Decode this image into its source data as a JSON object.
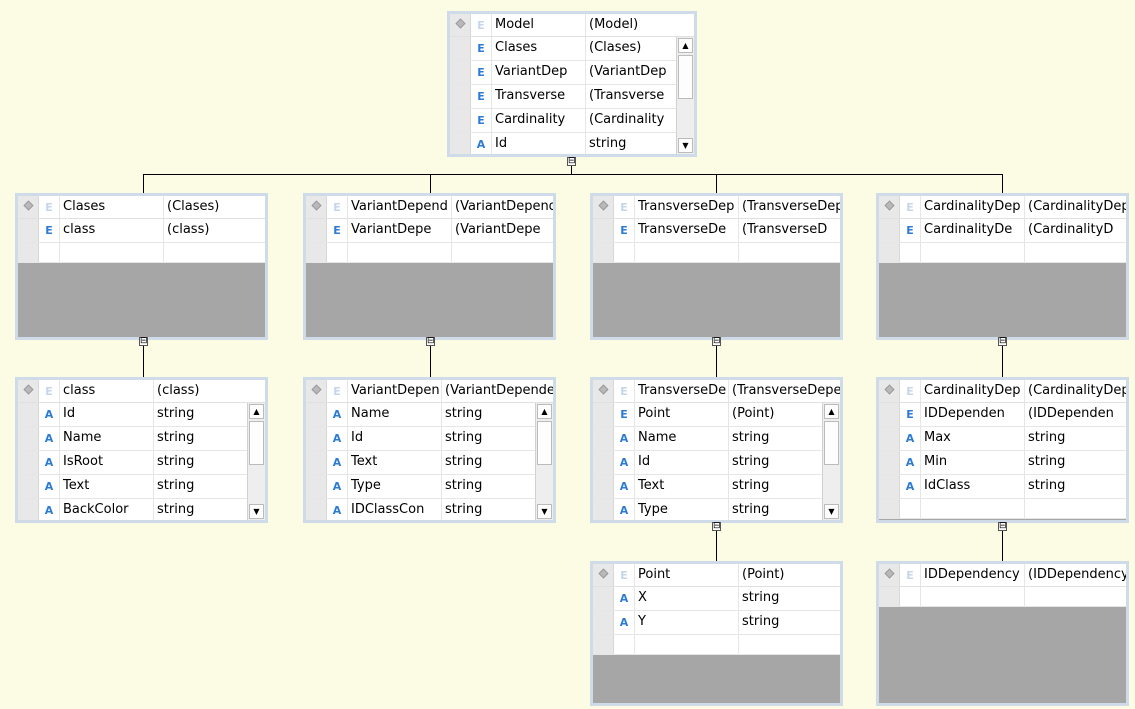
{
  "nodes": [
    {
      "id": "model",
      "header": {
        "name": "Model",
        "type": "(Model)"
      },
      "rows": [
        {
          "kind": "E",
          "name": "Clases",
          "type": "(Clases)"
        },
        {
          "kind": "E",
          "name": "VariantDep",
          "type": "(VariantDep"
        },
        {
          "kind": "E",
          "name": "Transverse",
          "type": "(Transverse"
        },
        {
          "kind": "E",
          "name": "Cardinality",
          "type": "(Cardinality"
        },
        {
          "kind": "A",
          "name": "Id",
          "type": "string"
        }
      ]
    },
    {
      "id": "clases",
      "header": {
        "name": "Clases",
        "type": "(Clases)"
      },
      "rows": [
        {
          "kind": "E",
          "name": "class",
          "type": "(class)"
        }
      ]
    },
    {
      "id": "variant-dependencies",
      "header": {
        "name": "VariantDepend",
        "type": "(VariantDepend"
      },
      "rows": [
        {
          "kind": "E",
          "name": "VariantDepe",
          "type": "(VariantDepe"
        }
      ]
    },
    {
      "id": "transverse-dependencies",
      "header": {
        "name": "TransverseDep",
        "type": "(TransverseDep"
      },
      "rows": [
        {
          "kind": "E",
          "name": "TransverseDe",
          "type": "(TransverseD"
        }
      ]
    },
    {
      "id": "cardinality-dependencies",
      "header": {
        "name": "CardinalityDep",
        "type": "(CardinalityDep"
      },
      "rows": [
        {
          "kind": "E",
          "name": "CardinalityDe",
          "type": "(CardinalityD"
        }
      ]
    },
    {
      "id": "class",
      "header": {
        "name": "class",
        "type": "(class)"
      },
      "rows": [
        {
          "kind": "A",
          "name": "Id",
          "type": "string"
        },
        {
          "kind": "A",
          "name": "Name",
          "type": "string"
        },
        {
          "kind": "A",
          "name": "IsRoot",
          "type": "string"
        },
        {
          "kind": "A",
          "name": "Text",
          "type": "string"
        },
        {
          "kind": "A",
          "name": "BackColor",
          "type": "string"
        }
      ]
    },
    {
      "id": "variant-dependency",
      "header": {
        "name": "VariantDepen",
        "type": "(VariantDepende"
      },
      "rows": [
        {
          "kind": "A",
          "name": "Name",
          "type": "string"
        },
        {
          "kind": "A",
          "name": "Id",
          "type": "string"
        },
        {
          "kind": "A",
          "name": "Text",
          "type": "string"
        },
        {
          "kind": "A",
          "name": "Type",
          "type": "string"
        },
        {
          "kind": "A",
          "name": "IDClassCon",
          "type": "string"
        }
      ]
    },
    {
      "id": "transverse-dependency",
      "header": {
        "name": "TransverseDe",
        "type": "(TransverseDepe"
      },
      "rows": [
        {
          "kind": "E",
          "name": "Point",
          "type": "(Point)"
        },
        {
          "kind": "A",
          "name": "Name",
          "type": "string"
        },
        {
          "kind": "A",
          "name": "Id",
          "type": "string"
        },
        {
          "kind": "A",
          "name": "Text",
          "type": "string"
        },
        {
          "kind": "A",
          "name": "Type",
          "type": "string"
        }
      ]
    },
    {
      "id": "cardinality-dependency",
      "header": {
        "name": "CardinalityDep",
        "type": "(CardinalityDep"
      },
      "rows": [
        {
          "kind": "E",
          "name": "IDDependen",
          "type": "(IDDependen"
        },
        {
          "kind": "A",
          "name": "Max",
          "type": "string"
        },
        {
          "kind": "A",
          "name": "Min",
          "type": "string"
        },
        {
          "kind": "A",
          "name": "IdClass",
          "type": "string"
        }
      ]
    },
    {
      "id": "point",
      "header": {
        "name": "Point",
        "type": "(Point)"
      },
      "rows": [
        {
          "kind": "A",
          "name": "X",
          "type": "string"
        },
        {
          "kind": "A",
          "name": "Y",
          "type": "string"
        }
      ]
    },
    {
      "id": "id-dependency",
      "header": {
        "name": "IDDependency",
        "type": "(IDDependency"
      },
      "rows": []
    }
  ],
  "toggle_symbol": "⊟",
  "colors": {
    "canvas": "#fcfbe3",
    "node_border": "#cfdbe9",
    "node_fill": "#a6a6a6",
    "kind_letter": "#2e7bd6",
    "connector": "#000000"
  },
  "icons": {
    "expand_handle": "diamond-icon",
    "scroll_up": "scroll-up-arrow-icon",
    "scroll_down": "scroll-down-arrow-icon"
  }
}
